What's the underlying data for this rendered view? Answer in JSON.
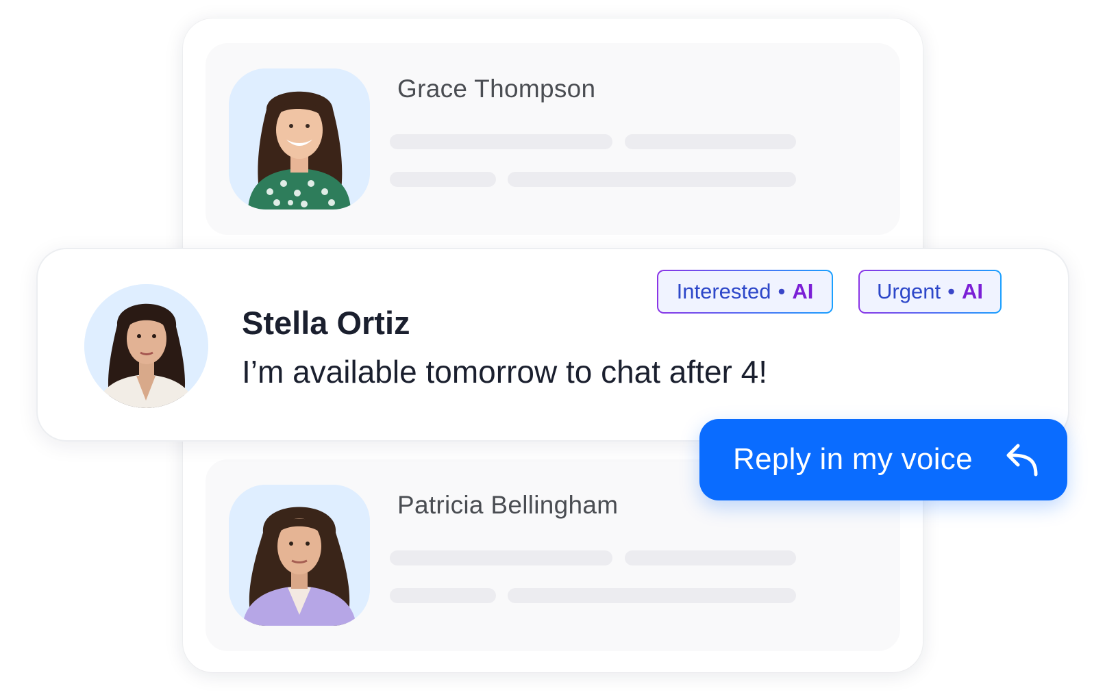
{
  "contacts": {
    "top": {
      "name": "Grace Thompson"
    },
    "bottom": {
      "name": "Patricia Bellingham"
    }
  },
  "message": {
    "sender": "Stella Ortiz",
    "text": "I’m available tomorrow to chat after 4!",
    "tags": [
      {
        "label": "Interested",
        "separator": "•",
        "ai": "AI"
      },
      {
        "label": "Urgent",
        "separator": "•",
        "ai": "AI"
      }
    ]
  },
  "reply_button": {
    "label": "Reply in my voice",
    "icon": "reply-arrow-icon"
  },
  "colors": {
    "primary": "#0a6cff",
    "tag_gradient_start": "#8a34e6",
    "tag_gradient_end": "#1aa0ff",
    "avatar_bg": "#dfeeff"
  }
}
